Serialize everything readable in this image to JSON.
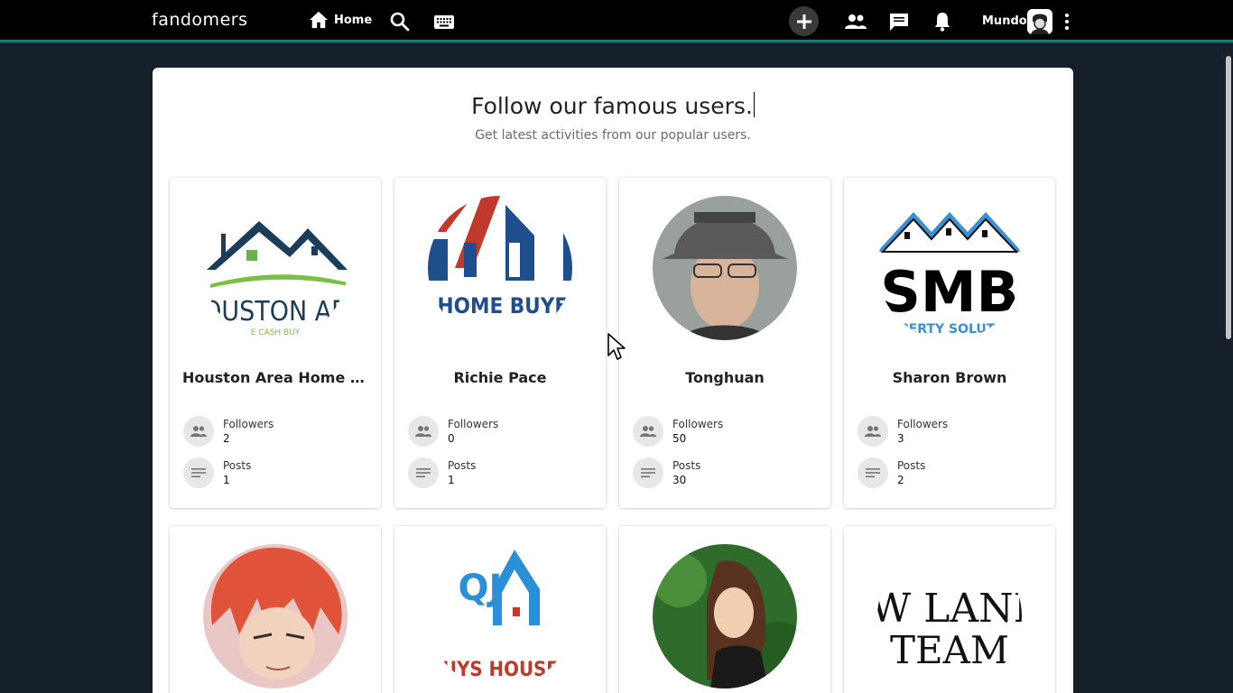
{
  "app": {
    "logo": "fandomers",
    "nav_home_label": "Home",
    "user_name": "Mundo"
  },
  "colors": {
    "topbar": "#000000",
    "accent_line": "#2b8c8a",
    "background": "#15202b",
    "panel": "#ffffff"
  },
  "icons": [
    "home-icon",
    "search-icon",
    "keyboard-icon",
    "plus-icon",
    "people-icon",
    "chat-icon",
    "bell-icon",
    "more-vert-icon",
    "followers-icon",
    "posts-icon"
  ],
  "section": {
    "title": "Follow our famous users.",
    "subtitle": "Get latest activities from our popular users."
  },
  "stat_labels": {
    "followers": "Followers",
    "posts": "Posts"
  },
  "users": [
    {
      "name": "Houston Area Home Cas…",
      "followers": "2",
      "posts": "1",
      "avatar_text": [
        "OUSTON AR",
        "E CASH BUY"
      ]
    },
    {
      "name": "Richie Pace",
      "followers": "0",
      "posts": "1",
      "avatar_text": [
        "E HOME BUYER"
      ]
    },
    {
      "name": "Tonghuan",
      "followers": "50",
      "posts": "30",
      "avatar_text": []
    },
    {
      "name": "Sharon Brown",
      "followers": "3",
      "posts": "2",
      "avatar_text": [
        "SMB",
        "PERTY SOLUTI"
      ]
    },
    {
      "name": "",
      "followers": "",
      "posts": "",
      "avatar_text": []
    },
    {
      "name": "",
      "followers": "",
      "posts": "",
      "avatar_text": [
        "QJ",
        "BUYS HOUSES"
      ]
    },
    {
      "name": "",
      "followers": "",
      "posts": "",
      "avatar_text": []
    },
    {
      "name": "",
      "followers": "",
      "posts": "",
      "avatar_text": [
        "W LANI",
        "TEAM"
      ]
    }
  ]
}
